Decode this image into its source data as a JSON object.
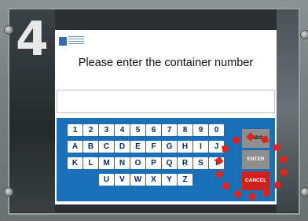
{
  "step_number": "4",
  "screen": {
    "prompt": "Please enter the container number",
    "input_value": ""
  },
  "keypad": {
    "rows": [
      [
        "1",
        "2",
        "3",
        "4",
        "5",
        "6",
        "7",
        "8",
        "9",
        "0"
      ],
      [
        "A",
        "B",
        "C",
        "D",
        "E",
        "F",
        "G",
        "H",
        "I",
        "J"
      ],
      [
        "K",
        "L",
        "M",
        "N",
        "O",
        "P",
        "Q",
        "R",
        "S",
        "T"
      ],
      [
        "U",
        "V",
        "W",
        "X",
        "Y",
        "Z"
      ]
    ],
    "undo_label": "UNDO",
    "enter_label": "ENTER",
    "cancel_label": "CANCEL"
  },
  "colors": {
    "keypad_blue": "#1b6fb6",
    "cancel_red": "#d2201f",
    "highlight_red": "#e2231a"
  }
}
